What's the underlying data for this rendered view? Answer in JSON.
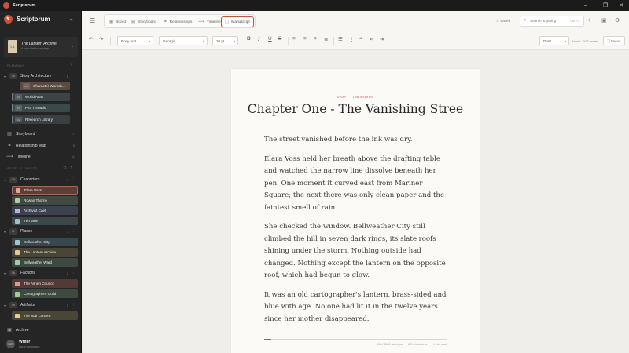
{
  "app": {
    "title": "Scriptorum"
  },
  "window_controls": [
    "–",
    "❐",
    "✕"
  ],
  "sidebar": {
    "brand": "Scriptorum",
    "project": {
      "cover_text": "LA",
      "title": "The Lantern Archive",
      "subtitle": "A speculative mystery"
    },
    "planning_heading": "PLANNING",
    "story_architecture": {
      "abbr": "SA",
      "label": "Story Architecture",
      "count": "5"
    },
    "architecture_items": [
      {
        "abbr": "CW",
        "label": "Character Worksh..."
      },
      {
        "abbr": "WA",
        "label": "World Atlas"
      },
      {
        "abbr": "PT",
        "label": "Plot Threads"
      },
      {
        "abbr": "RL",
        "label": "Research Library"
      }
    ],
    "nav": [
      {
        "label": "Storyboard",
        "count": "17"
      },
      {
        "label": "Relationship Map",
        "count": "9"
      },
      {
        "label": "Timeline",
        "count": "11"
      }
    ],
    "elements_heading": "STORY ELEMENTS",
    "groups": [
      {
        "abbr": "CH",
        "label": "Characters",
        "count": "4",
        "items": [
          "Elara Voss",
          "Rowan Thorne",
          "Archivist Cael",
          "Iren Vale"
        ]
      },
      {
        "abbr": "PL",
        "label": "Places",
        "count": "3",
        "items": [
          "Bellweather City",
          "The Lantern Archive",
          "Bellweather Ward"
        ]
      },
      {
        "abbr": "FA",
        "label": "Factions",
        "count": "2",
        "items": [
          "The Ashen Council",
          "Cartographers Guild"
        ]
      },
      {
        "abbr": "AR",
        "label": "Artifacts",
        "count": "1",
        "items": [
          "The Star Lantern"
        ]
      }
    ],
    "archive_label": "Archive",
    "user": {
      "initials": "WR",
      "name": "Writer",
      "role": "Local workspace"
    }
  },
  "topbar": {
    "tabs": [
      {
        "icon": "▦",
        "label": "Board"
      },
      {
        "icon": "▤",
        "label": "Storyboard"
      },
      {
        "icon": "⚭",
        "label": "Relationships"
      },
      {
        "icon": "⟿",
        "label": "Timeline"
      },
      {
        "icon": "▢",
        "label": "Manuscript"
      }
    ],
    "saved_label": "Saved",
    "search_placeholder": "Search anything",
    "search_shortcut": "Ctrl + K"
  },
  "formatbar": {
    "paragraph_style": "Body text",
    "font": "Georgia",
    "size": "20 pt",
    "status": "Draft",
    "goal_label": "Novel · 217 words",
    "focus_label": "Focus"
  },
  "manuscript": {
    "eyebrow": "DRAFT · 198 WORDS",
    "title": "Chapter One - The Vanishing Stree",
    "paragraphs": [
      "The street vanished before the ink was dry.",
      "Elara Voss held her breath above the drafting table and watched the narrow line dissolve beneath her pen. One moment it curved east from Mariner Square; the next there was only clean paper and the faintest smell of rain.",
      "She checked the window. Bellweather City still climbed the hill in seven dark rings, its slate roofs shining under the storm. Nothing outside had changed. Nothing except the lantern on the opposite roof, which had begun to glow.",
      "It was an old cartographer's lantern, brass-sided and blue with age. No one had lit it in the twelve years since her mother disappeared."
    ],
    "progress": 0.04,
    "stats": [
      "198 / 5000 word goal",
      "621 characters",
      "~1 min read"
    ]
  },
  "colors": {
    "accent": "#c9503c",
    "sidebar_bg": "#252525",
    "editor_bg": "#efeeea",
    "page_bg": "#fbfaf6"
  }
}
